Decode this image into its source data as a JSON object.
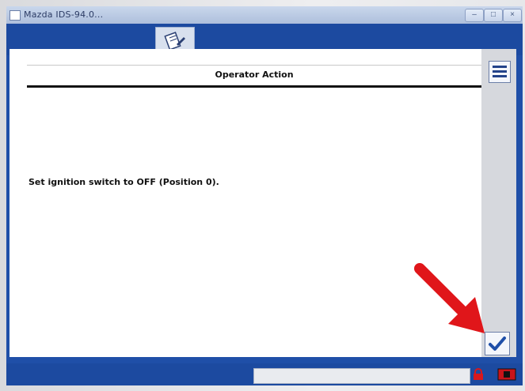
{
  "window": {
    "title": "Mazda IDS-94.0..."
  },
  "toolbar": {
    "active_tool_icon": "notebook-pen-icon"
  },
  "panel": {
    "title": "Operator Action",
    "message": "Set ignition switch to OFF (Position 0)."
  },
  "side_buttons": {
    "list_icon": "list-icon",
    "confirm_icon": "checkmark-icon"
  },
  "statusbar": {
    "status_text": "",
    "lock_icon": "padlock-icon",
    "exit_icon": "exit-icon"
  },
  "colors": {
    "frame_blue": "#1c4aa0",
    "arrow_red": "#e0161a",
    "check_blue": "#1f4fa8"
  }
}
